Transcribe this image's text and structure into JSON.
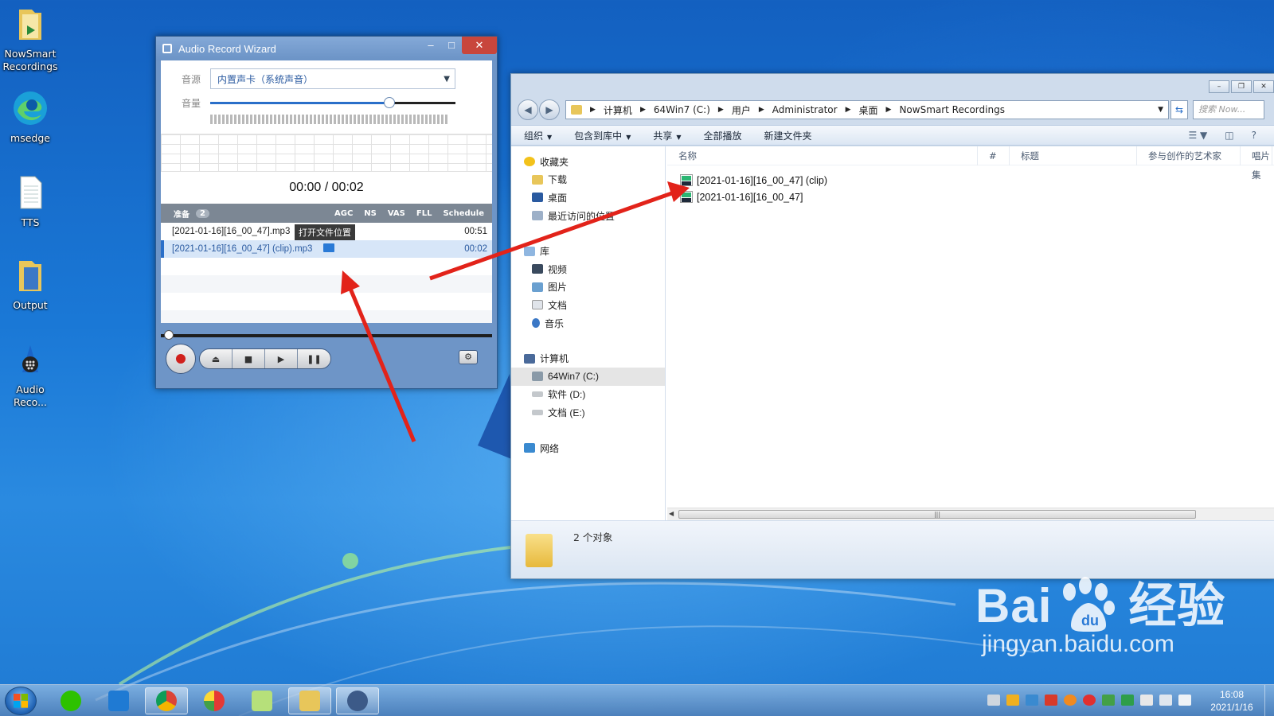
{
  "desktop": {
    "icons": [
      {
        "label": "NowSmart Recordings",
        "icon": "folder-icon"
      },
      {
        "label": "msedge",
        "icon": "edge-icon"
      },
      {
        "label": "TTS",
        "icon": "text-file-icon"
      },
      {
        "label": "Output",
        "icon": "folder-icon"
      },
      {
        "label": "Audio Reco...",
        "icon": "audio-recorder-icon"
      }
    ]
  },
  "recorder": {
    "title": "Audio Record Wizard",
    "source_label": "音源",
    "source_value": "内置声卡（系统声音）",
    "volume_label": "音量",
    "volume_level": 0.73,
    "time_display": "00:00 / 00:02",
    "list_header": {
      "status": "准备",
      "count": "2",
      "columns": [
        "AGC",
        "NS",
        "VAS",
        "FLL",
        "Schedule"
      ]
    },
    "files": [
      {
        "name": "[2021-01-16][16_00_47].mp3",
        "duration": "00:51",
        "selected": false
      },
      {
        "name": "[2021-01-16][16_00_47] (clip).mp3",
        "duration": "00:02",
        "selected": true
      }
    ],
    "tooltip": "打开文件位置",
    "playback_position": 0.0,
    "controls": [
      "record",
      "eject",
      "stop",
      "play",
      "pause",
      "settings"
    ]
  },
  "explorer": {
    "breadcrumb": [
      "计算机",
      "64Win7 (C:)",
      "用户",
      "Administrator",
      "桌面",
      "NowSmart Recordings"
    ],
    "search_placeholder": "搜索 Now...",
    "toolbar": {
      "organize": "组织",
      "include_in_library": "包含到库中",
      "share": "共享",
      "play_all": "全部播放",
      "new_folder": "新建文件夹"
    },
    "nav": {
      "favorites": "收藏夹",
      "downloads": "下载",
      "desktop": "桌面",
      "recent": "最近访问的位置",
      "libraries": "库",
      "videos": "视频",
      "pictures": "图片",
      "documents": "文档",
      "music": "音乐",
      "computer": "计算机",
      "drive_c": "64Win7 (C:)",
      "drive_d": "软件 (D:)",
      "drive_e": "文档 (E:)",
      "network": "网络"
    },
    "columns": [
      "名称",
      "#",
      "标题",
      "参与创作的艺术家",
      "唱片集"
    ],
    "files": [
      {
        "name": "[2021-01-16][16_00_47] (clip)",
        "icon": "mp3-file-icon"
      },
      {
        "name": "[2021-01-16][16_00_47]",
        "icon": "mp3-file-icon"
      }
    ],
    "status": "2 个对象"
  },
  "taskbar": {
    "apps": [
      "wechat",
      "vscode",
      "chrome",
      "color-picker",
      "notepad-plus",
      "file-explorer",
      "audio-recorder"
    ],
    "clock_time": "16:08",
    "clock_date": "2021/1/16"
  },
  "watermark": {
    "brand": "Bai",
    "brand_tail": "经验",
    "url": "jingyan.baidu.com"
  },
  "colors": {
    "accent": "#2a6fc9",
    "record_red": "#d0201c",
    "annotation_arrow": "#e2231a"
  }
}
